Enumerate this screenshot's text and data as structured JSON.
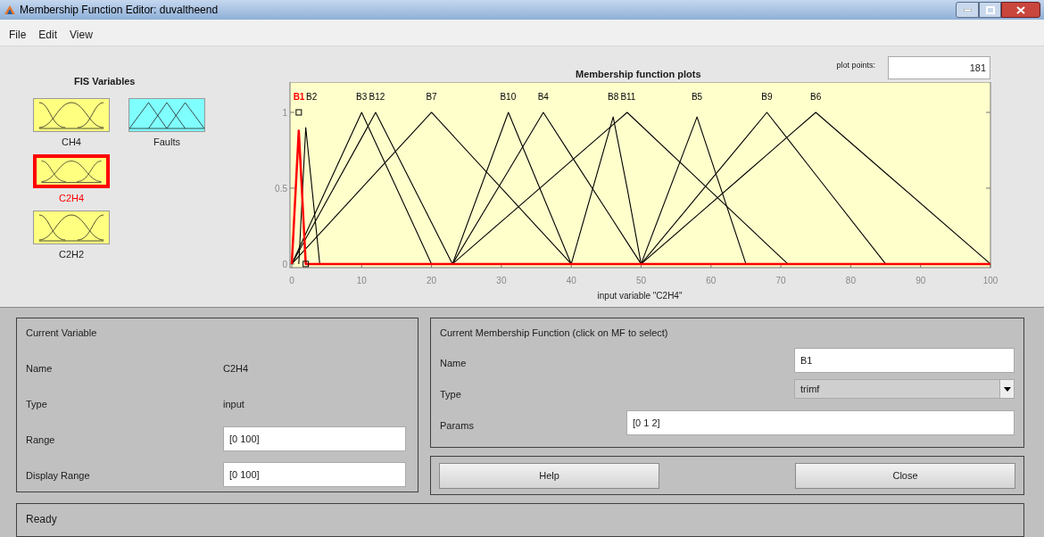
{
  "window": {
    "title": "Membership Function Editor: duvaltheend"
  },
  "menu": [
    "File",
    "Edit",
    "View"
  ],
  "fis_variables": {
    "title": "FIS Variables",
    "items": [
      {
        "name": "CH4",
        "kind": "input",
        "selected": false
      },
      {
        "name": "Faults",
        "kind": "output",
        "selected": false
      },
      {
        "name": "C2H4",
        "kind": "input",
        "selected": true
      },
      {
        "name": "C2H2",
        "kind": "input",
        "selected": false
      }
    ]
  },
  "plot": {
    "plot_points_label": "plot points:",
    "plot_points": "181",
    "chart_data": {
      "type": "line",
      "title": "Membership function plots",
      "xlabel": "input variable \"C2H4\"",
      "xlim": [
        0,
        100
      ],
      "ylim": [
        -0.024,
        1.2
      ],
      "xticks": [
        0,
        10,
        20,
        30,
        40,
        50,
        60,
        70,
        80,
        90,
        100
      ],
      "yticks": [
        0,
        0.5,
        1
      ],
      "x": [
        0,
        1,
        2,
        4,
        10,
        12,
        20,
        23,
        31,
        36,
        40,
        46,
        48,
        50,
        58,
        65,
        68,
        71,
        75,
        85,
        100
      ],
      "series": [
        {
          "name": "B1",
          "color": "#ff0000",
          "values": [
            0,
            0.88,
            0,
            0,
            0,
            0,
            0,
            0,
            0,
            0,
            0,
            0,
            0,
            0,
            0,
            0,
            0,
            0,
            0,
            0,
            0
          ]
        },
        {
          "name": "B2",
          "color": "#000000",
          "values": [
            null,
            0,
            0.9,
            0,
            null,
            null,
            null,
            null,
            null,
            null,
            null,
            null,
            null,
            null,
            null,
            null,
            null,
            null,
            null,
            null,
            null
          ]
        },
        {
          "name": "B3",
          "color": "#000000",
          "values": [
            0,
            0.1,
            0.2,
            0.4,
            1,
            0.8,
            0,
            null,
            null,
            null,
            null,
            null,
            null,
            null,
            null,
            null,
            null,
            null,
            null,
            null,
            null
          ]
        },
        {
          "name": "B12",
          "color": "#000000",
          "values": [
            0,
            0.083,
            0.167,
            0.333,
            0.833,
            1,
            0.273,
            0,
            null,
            null,
            null,
            null,
            null,
            null,
            null,
            null,
            null,
            null,
            null,
            null,
            null
          ]
        },
        {
          "name": "B7",
          "color": "#000000",
          "values": [
            0,
            0.05,
            0.1,
            0.2,
            0.5,
            0.6,
            1,
            0.85,
            0.45,
            0.2,
            0,
            null,
            null,
            null,
            null,
            null,
            null,
            null,
            null,
            null,
            null
          ]
        },
        {
          "name": "B10",
          "color": "#000000",
          "values": [
            null,
            null,
            null,
            null,
            null,
            null,
            null,
            0,
            1,
            0.444,
            0,
            null,
            null,
            null,
            null,
            null,
            null,
            null,
            null,
            null,
            null
          ]
        },
        {
          "name": "B4",
          "color": "#000000",
          "values": [
            null,
            null,
            null,
            null,
            null,
            null,
            null,
            0,
            0.615,
            1,
            0.714,
            0.286,
            0.143,
            0,
            null,
            null,
            null,
            null,
            null,
            null,
            null
          ]
        },
        {
          "name": "B8",
          "color": "#000000",
          "values": [
            null,
            null,
            null,
            null,
            null,
            null,
            null,
            null,
            null,
            null,
            0,
            0.97,
            0.5,
            0,
            null,
            null,
            null,
            null,
            null,
            null,
            null
          ]
        },
        {
          "name": "B11",
          "color": "#000000",
          "values": [
            null,
            null,
            null,
            null,
            null,
            null,
            null,
            0,
            0.32,
            0.52,
            0.68,
            0.92,
            1,
            0.913,
            0.565,
            0.261,
            0.13,
            0,
            null,
            null,
            null
          ]
        },
        {
          "name": "B5",
          "color": "#000000",
          "values": [
            null,
            null,
            null,
            null,
            null,
            null,
            null,
            null,
            null,
            null,
            null,
            null,
            null,
            0,
            0.97,
            0,
            null,
            null,
            null,
            null,
            null
          ]
        },
        {
          "name": "B9",
          "color": "#000000",
          "values": [
            null,
            null,
            null,
            null,
            null,
            null,
            null,
            null,
            null,
            null,
            null,
            null,
            null,
            0,
            0.444,
            0.833,
            1,
            0.824,
            0.588,
            0,
            null
          ]
        },
        {
          "name": "B6",
          "color": "#000000",
          "values": [
            null,
            null,
            null,
            null,
            null,
            null,
            null,
            null,
            null,
            null,
            null,
            null,
            null,
            0,
            0.32,
            0.6,
            0.72,
            0.84,
            1,
            0.6,
            0
          ]
        }
      ]
    }
  },
  "current_variable": {
    "title": "Current Variable",
    "rows": [
      {
        "label": "Name",
        "value": "C2H4",
        "kind": "text"
      },
      {
        "label": "Type",
        "value": "input",
        "kind": "text"
      },
      {
        "label": "Range",
        "value": "[0 100]",
        "kind": "field"
      },
      {
        "label": "Display Range",
        "value": "[0 100]",
        "kind": "field"
      }
    ]
  },
  "current_mf": {
    "title": "Current Membership Function (click on MF to select)",
    "rows": [
      {
        "label": "Name",
        "value": "B1",
        "kind": "field"
      },
      {
        "label": "Type",
        "value": "trimf",
        "kind": "dropdown"
      },
      {
        "label": "Params",
        "value": "[0 1 2]",
        "kind": "wide_field"
      }
    ]
  },
  "buttons": [
    "Help",
    "Close"
  ],
  "status_bar": "Ready"
}
